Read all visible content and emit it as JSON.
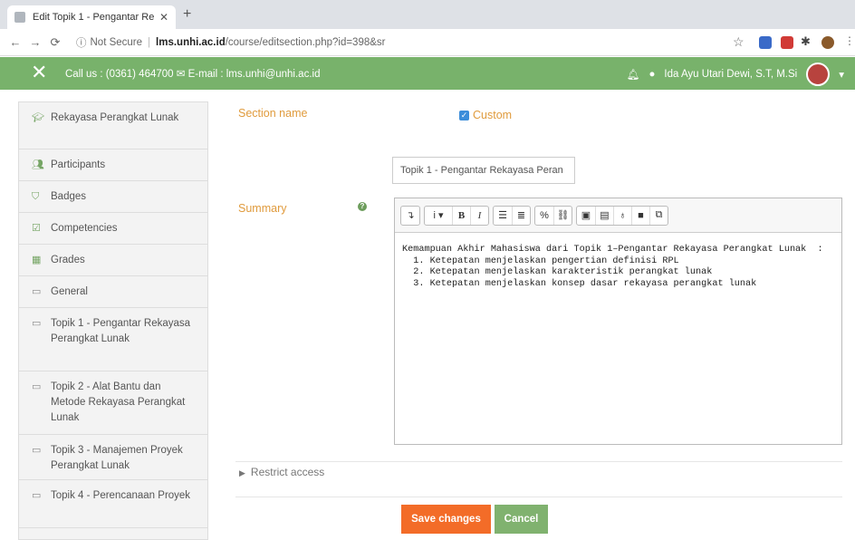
{
  "browser": {
    "tab_title": "Edit Topik 1 - Pengantar Rekay",
    "new_tab": "+",
    "close": "✕",
    "url_prefix": "Not Secure",
    "url_host": "lms.unhi.ac.id",
    "url_path": "/course/editsection.php?id=398&sr"
  },
  "topnav": {
    "contact": "Call us : (0361) 464700  ✉ E-mail : lms.unhi@unhi.ac.id",
    "user": "Ida Ayu Utari Dewi, S.T, M.Si"
  },
  "sidebar": {
    "items": [
      {
        "label": "Rekayasa Perangkat Lunak",
        "icon": "graduation-cap-icon"
      },
      {
        "label": "Participants",
        "icon": "users-icon"
      },
      {
        "label": "Badges",
        "icon": "shield-icon"
      },
      {
        "label": "Competencies",
        "icon": "check-square-icon"
      },
      {
        "label": "Grades",
        "icon": "table-icon"
      },
      {
        "label": "General",
        "icon": "folder-icon"
      },
      {
        "label": "Topik 1 - Pengantar Rekayasa Perangkat Lunak",
        "icon": "folder-icon"
      },
      {
        "label": "Topik 2 - Alat Bantu dan Metode Rekayasa Perangkat Lunak",
        "icon": "folder-icon"
      },
      {
        "label": "Topik 3 - Manajemen Proyek Perangkat Lunak",
        "icon": "folder-icon"
      },
      {
        "label": "Topik 4 - Perencanaan Proyek",
        "icon": "folder-icon"
      }
    ]
  },
  "form": {
    "section_label": "Section name",
    "custom_label": "Custom",
    "name_value": "Topik 1 - Pengantar Rekayasa Peran",
    "summary_label": "Summary",
    "summary_text": "Kemampuan Akhir Mahasiswa dari Topik 1–Pengantar Rekayasa Perangkat Lunak  :\n  1. Ketepatan menjelaskan pengertian definisi RPL\n  2. Ketepatan menjelaskan karakteristik perangkat lunak\n  3. Ketepatan menjelaskan konsep dasar rekayasa perangkat lunak",
    "restrict": "Restrict access",
    "save": "Save changes",
    "cancel": "Cancel"
  },
  "colors": {
    "nav": "#78b26b",
    "label": "#e09b3d",
    "save": "#f36c28",
    "cancel": "#80b26f"
  }
}
